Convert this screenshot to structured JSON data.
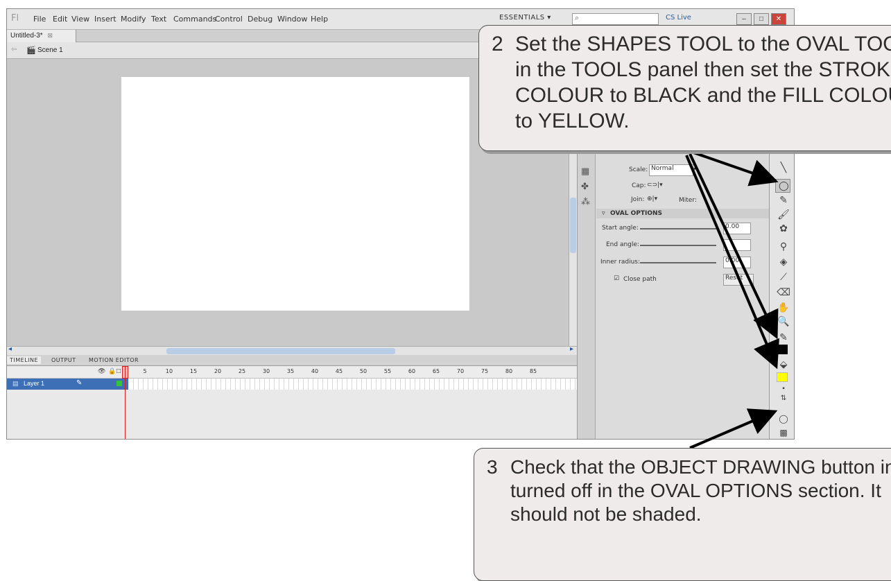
{
  "menubar": {
    "logo": "Fl",
    "items": [
      "File",
      "Edit",
      "View",
      "Insert",
      "Modify",
      "Text",
      "Commands",
      "Control",
      "Debug",
      "Window",
      "Help"
    ],
    "workspace": "ESSENTIALS ▾",
    "cs_live": "CS Live"
  },
  "document": {
    "tab_label": "Untitled-3*",
    "scene": "Scene 1"
  },
  "timeline": {
    "tabs": [
      "TIMELINE",
      "OUTPUT",
      "MOTION EDITOR"
    ],
    "frame_numbers": [
      "5",
      "10",
      "15",
      "20",
      "25",
      "30",
      "35",
      "40",
      "45",
      "50",
      "55",
      "60",
      "65",
      "70",
      "75",
      "80",
      "85"
    ],
    "layer_name": "Layer 1"
  },
  "properties": {
    "scale_label": "Scale:",
    "scale_value": "Normal",
    "cap_label": "Cap:",
    "join_label": "Join:",
    "miter_label": "Miter:",
    "oval_options_title": "OVAL OPTIONS",
    "start_angle_label": "Start angle:",
    "start_angle_value": "0.00",
    "end_angle_label": "End angle:",
    "inner_radius_label": "Inner radius:",
    "inner_radius_value": "0.00",
    "close_path_label": "Close path",
    "reset_label": "Reset"
  },
  "tools": {
    "stroke_color": "#000000",
    "fill_color": "#ffff00"
  },
  "callouts": {
    "step2_number": "2",
    "step2_text": "Set the SHAPES TOOL to the OVAL TOOL in the TOOLS panel then set the STROKE COLOUR to BLACK and the FILL COLOUR to YELLOW.",
    "step3_number": "3",
    "step3_text": "Check that the OBJECT DRAWING button in turned off in the OVAL OPTIONS section. It should not be shaded."
  }
}
